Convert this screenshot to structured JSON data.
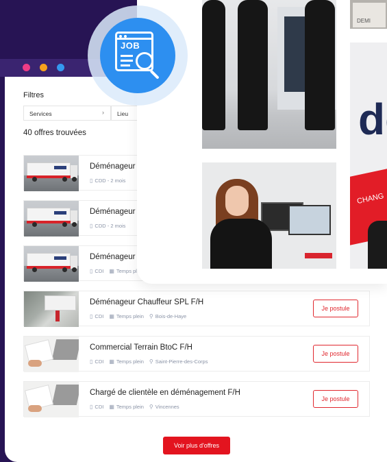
{
  "filters": {
    "title": "Filtres",
    "services_placeholder": "Services",
    "lieu_placeholder": "Lieu"
  },
  "results": {
    "count_label": "40 offres trouvées"
  },
  "jobs": [
    {
      "title": "Déménageur F",
      "contract": "CDD - 2 mois",
      "time": "",
      "location": "",
      "thumbnail": "truck"
    },
    {
      "title": "Déménageur F",
      "contract": "CDD - 2 mois",
      "time": "",
      "location": "",
      "thumbnail": "truck"
    },
    {
      "title": "Déménageur F",
      "contract": "CDI",
      "time": "Temps pl",
      "location": "",
      "thumbnail": "truck"
    },
    {
      "title": "Déménageur Chauffeur SPL F/H",
      "contract": "CDI",
      "time": "Temps plein",
      "location": "Bois-de-Haye",
      "apply_label": "Je postule",
      "thumbnail": "street"
    },
    {
      "title": "Commercial Terrain BtoC F/H",
      "contract": "CDI",
      "time": "Temps plein",
      "location": "Saint-Pierre-des-Corps",
      "apply_label": "Je postule",
      "thumbnail": "desk"
    },
    {
      "title": "Chargé de clientèle en déménagement F/H",
      "contract": "CDI",
      "time": "Temps plein",
      "location": "Vincennes",
      "apply_label": "Je postule",
      "thumbnail": "desk"
    }
  ],
  "more_button": "Voir plus d'offres",
  "badge": {
    "label": "JOB"
  },
  "banner": {
    "big_text": "de",
    "sub_text": "CHANG"
  },
  "sign": {
    "text": "DEMI"
  },
  "colors": {
    "purple": "#271454",
    "accent_red": "#e3141f",
    "badge_blue": "#2d8ff0",
    "dot_pink": "#ee3c86",
    "dot_orange": "#f7a21d",
    "dot_blue": "#3498ef"
  },
  "icons": [
    "document-icon",
    "calendar-icon",
    "location-pin-icon",
    "job-search-icon",
    "chevron-right-icon"
  ]
}
